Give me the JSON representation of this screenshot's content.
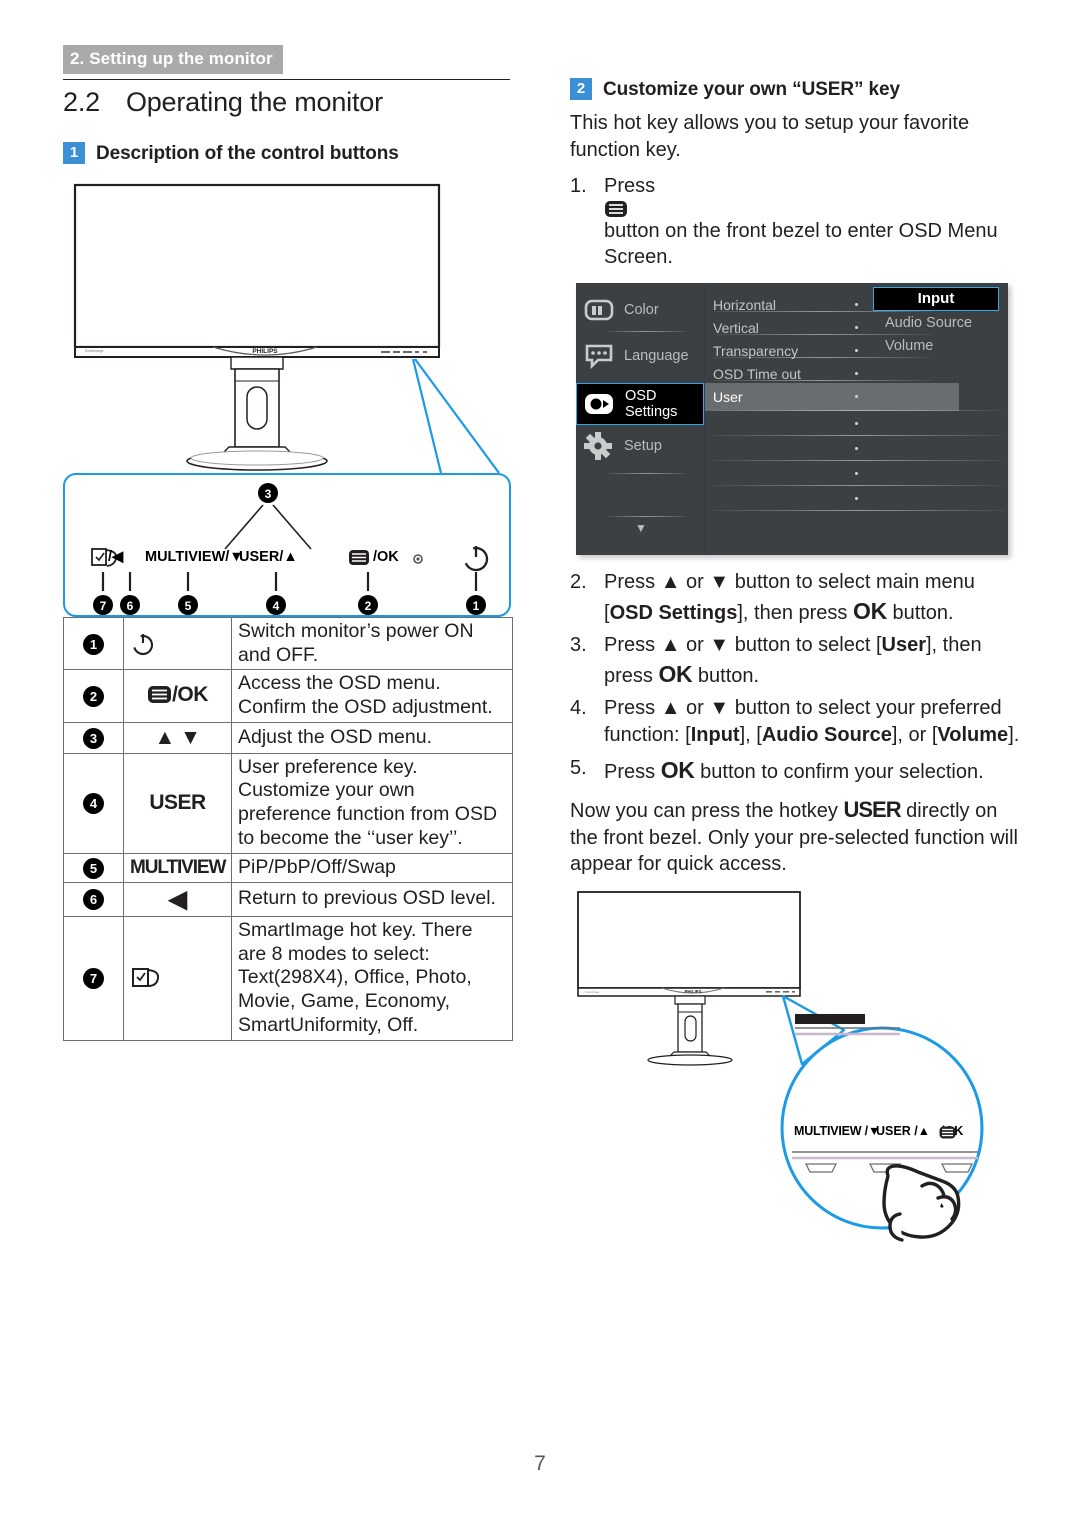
{
  "running_header": "2. Setting up the monitor",
  "page_number": "7",
  "colors": {
    "accent_blue": "#3b8fd4",
    "callout_blue": "#1b9ae8",
    "header_gray": "#aaaaaa",
    "osd_bg": "#3d4043",
    "osd_select_border": "#36a6e6"
  },
  "left_column": {
    "section_number": "2.2",
    "section_title": "Operating the monitor",
    "sub_badge": "1",
    "sub_title": "Description of the control buttons",
    "monitor_brand": "PHILIPS",
    "bezel_buttons": [
      {
        "label": "⎘/◀",
        "callouts": [
          "7",
          "6"
        ]
      },
      {
        "label": "MULTIVIEW/▼",
        "callouts": [
          "5"
        ]
      },
      {
        "label": "USER/▲",
        "callouts": [
          "4"
        ]
      },
      {
        "label": "☰/OK",
        "callouts": [
          "2"
        ]
      },
      {
        "label": "",
        "callouts": []
      },
      {
        "label": "⏻",
        "callouts": [
          "1"
        ]
      }
    ],
    "updown_callout": "3",
    "table": {
      "rows": [
        {
          "num": "1",
          "icon": "power-icon",
          "icon_text": "",
          "desc": "Switch monitor’s power ON and OFF."
        },
        {
          "num": "2",
          "icon": "menu-ok",
          "icon_text": "/OK",
          "desc_line1": "Access the OSD menu.",
          "desc_line2": "Confirm the OSD adjustment."
        },
        {
          "num": "3",
          "icon": "up-down-arrows",
          "icon_text": "▲ ▼",
          "desc": "Adjust the OSD menu."
        },
        {
          "num": "4",
          "icon": "user-key",
          "icon_text": "USER",
          "desc": "User preference key. Customize your own preference function from OSD to become the ‘‘user key’’."
        },
        {
          "num": "5",
          "icon": "multiview-key",
          "icon_text": "MULTIVIEW",
          "desc": "PiP/PbP/Off/Swap"
        },
        {
          "num": "6",
          "icon": "left-arrow",
          "icon_text": "◀",
          "desc": "Return to previous OSD level."
        },
        {
          "num": "7",
          "icon": "smartimage-icon",
          "icon_text": "",
          "desc": "SmartImage hot key. There are 8 modes to select: Text(298X4), Office, Photo, Movie, Game, Economy, SmartUniformity, Off."
        }
      ]
    }
  },
  "right_column": {
    "badge": "2",
    "title": "Customize your own “USER” key",
    "intro": "This hot key allows you to setup your favorite function key.",
    "steps": [
      {
        "n": "1.",
        "pre": "Press ",
        "icon": "menu-icon",
        "post": " button on the front bezel to enter OSD Menu Screen."
      },
      {
        "n": "2.",
        "text_parts": [
          "Press ",
          "▲",
          " or ",
          "▼",
          " button to select main menu [",
          "OSD Settings",
          "], then press ",
          "OK",
          " button."
        ]
      },
      {
        "n": "3.",
        "text_parts": [
          "Press ",
          "▲",
          " or ",
          "▼",
          " button to select [",
          "User",
          "], then press ",
          "OK",
          " button."
        ]
      },
      {
        "n": "4.",
        "text_parts": [
          "Press ",
          "▲",
          " or ",
          "▼",
          " button to select your preferred function: [",
          "Input",
          "], [",
          "Audio Source",
          "], or [",
          "Volume",
          "]."
        ]
      },
      {
        "n": "5.",
        "text_parts": [
          "Press ",
          "OK",
          " button to confirm your selection."
        ]
      }
    ],
    "closing": {
      "part1": "Now you can press the hotkey ",
      "hotkey": "USER",
      "part2": " directly on the front bezel. Only your pre-selected function will appear for quick access."
    },
    "zoom_bezel_buttons": [
      "MULTIVIEW /▼",
      "USER /▲",
      "☰/OK"
    ],
    "osd": {
      "sidebar": [
        {
          "label": "Color",
          "icon": "color-icon",
          "selected": false
        },
        {
          "label": "Language",
          "icon": "language-icon",
          "selected": false
        },
        {
          "label": "OSD Settings",
          "icon": "osd-settings-icon",
          "selected": true
        },
        {
          "label": "Setup",
          "icon": "gear-icon",
          "selected": false
        }
      ],
      "scroll_indicator": "▼",
      "middle_items": [
        {
          "label": "Horizontal",
          "highlighted": false
        },
        {
          "label": "Vertical",
          "highlighted": false
        },
        {
          "label": "Transparency",
          "highlighted": false
        },
        {
          "label": "OSD Time out",
          "highlighted": false
        },
        {
          "label": "User",
          "highlighted": true
        }
      ],
      "right_items": [
        {
          "label": "Input",
          "selected": true
        },
        {
          "label": "Audio Source",
          "selected": false
        },
        {
          "label": "Volume",
          "selected": false
        }
      ]
    }
  }
}
